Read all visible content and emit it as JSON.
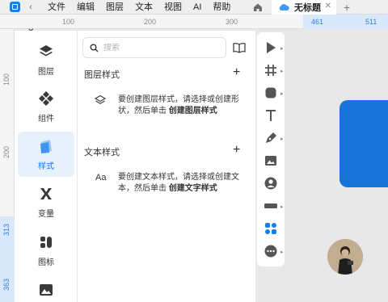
{
  "menu": [
    "文件",
    "编辑",
    "图层",
    "文本",
    "视图",
    "AI",
    "帮助"
  ],
  "tab": {
    "title": "无标题",
    "close": "✕",
    "add": "+"
  },
  "ruler_top": {
    "t100": "100",
    "t200": "200",
    "t300": "300",
    "t461": "461",
    "t511": "511"
  },
  "ruler_left": {
    "t100": "100",
    "t200": "200",
    "t313": "313",
    "t363": "363"
  },
  "nav": [
    "图层",
    "组件",
    "样式",
    "变量",
    "图标",
    "图片"
  ],
  "search": {
    "placeholder": "搜索"
  },
  "layer_styles": {
    "title": "图层样式",
    "add": "+",
    "hint": "要创建图层样式，请选择或创建形状，然后单击",
    "action": "创建图层样式"
  },
  "text_styles": {
    "title": "文本样式",
    "add": "+",
    "icon_text": "Aa",
    "hint": "要创建文本样式，请选择或创建文本，然后单击",
    "action": "创建文字样式"
  },
  "colors": {
    "accent": "#1677e6",
    "shape": "#1a73d9"
  }
}
